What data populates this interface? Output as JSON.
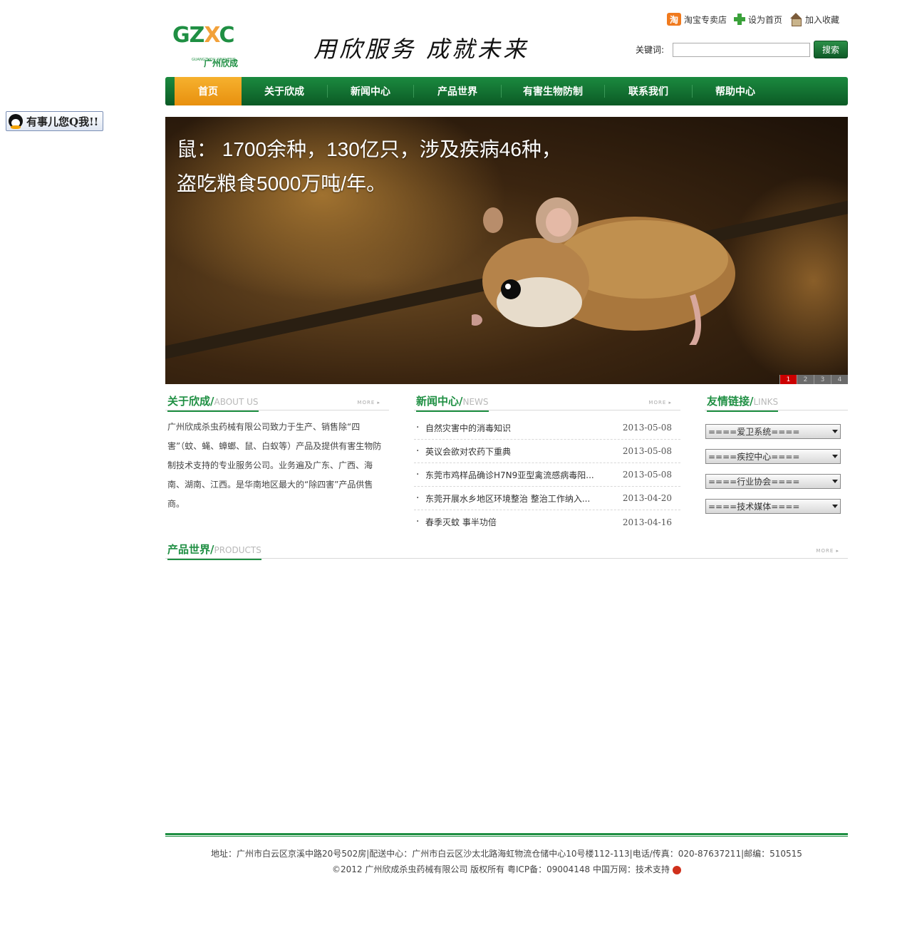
{
  "qq_badge": {
    "label": "有事儿您Q我!!",
    "icon": "qq-penguin-icon"
  },
  "header": {
    "logo_text": "GZXC",
    "logo_cn": "广州欣成",
    "logo_pinyin": "GUANGZHOU XINCHENG",
    "slogan": "用欣服务  成就未来",
    "top_links": [
      {
        "label": "淘宝专卖店",
        "icon": "taobao-icon"
      },
      {
        "label": "设为首页",
        "icon": "plus-icon"
      },
      {
        "label": "加入收藏",
        "icon": "home-icon"
      }
    ],
    "search": {
      "label": "关键词:",
      "value": "",
      "placeholder": "",
      "button": "搜索"
    }
  },
  "nav": {
    "items": [
      {
        "label": "首页",
        "active": true
      },
      {
        "label": "关于欣成"
      },
      {
        "label": "新闻中心"
      },
      {
        "label": "产品世界"
      },
      {
        "label": "有害生物防制"
      },
      {
        "label": "联系我们"
      },
      {
        "label": "帮助中心"
      }
    ]
  },
  "banner": {
    "line1": "鼠： 1700余种，130亿只，涉及疾病46种，",
    "line2": "盗吃粮食5000万吨/年。",
    "pages": [
      "1",
      "2",
      "3",
      "4"
    ],
    "active_page": 1
  },
  "about": {
    "title": "关于欣成/",
    "title_en": "ABOUT US",
    "more": "MORE ▸",
    "text": "广州欣成杀虫药械有限公司致力于生产、销售除“四害”（蚊、蝇、蟑螂、鼠、白蚁等）产品及提供有害生物防制技术支持的专业服务公司。业务遍及广东、广西、海南、湖南、江西。是华南地区最大的“除四害”产品供售商。"
  },
  "news": {
    "title": "新闻中心/",
    "title_en": "NEWS",
    "more": "MORE ▸",
    "items": [
      {
        "title": "自然灾害中的消毒知识",
        "date": "2013-05-08"
      },
      {
        "title": "英议会欲对农药下重典",
        "date": "2013-05-08"
      },
      {
        "title": "东莞市鸡样品确诊H7N9亚型禽流感病毒阳...",
        "date": "2013-05-08"
      },
      {
        "title": "东莞开展水乡地区环境整治 整治工作纳入...",
        "date": "2013-04-20"
      },
      {
        "title": "春季灭蚊 事半功倍",
        "date": "2013-04-16"
      }
    ]
  },
  "links": {
    "title": "友情链接/",
    "title_en": "LINKS",
    "selects": [
      "====爱卫系统====",
      "====疾控中心====",
      "====行业协会====",
      "====技术媒体===="
    ]
  },
  "products": {
    "title": "产品世界/",
    "title_en": "PRODUCTS",
    "more": "MORE ▸"
  },
  "footer": {
    "line1": "地址：广州市白云区京溪中路20号502房|配送中心：广州市白云区沙太北路海虹物流仓储中心10号楼112-113|电话/传真：020-87637211|邮编：510515",
    "line2": "©2012 广州欣成杀虫药械有限公司    版权所有    粤ICP备：09004148   中国万网：技术支持"
  },
  "colors": {
    "brand_green": "#1f8f43",
    "nav_active": "#f2a01f",
    "banner_dot_active": "#cc0000"
  }
}
